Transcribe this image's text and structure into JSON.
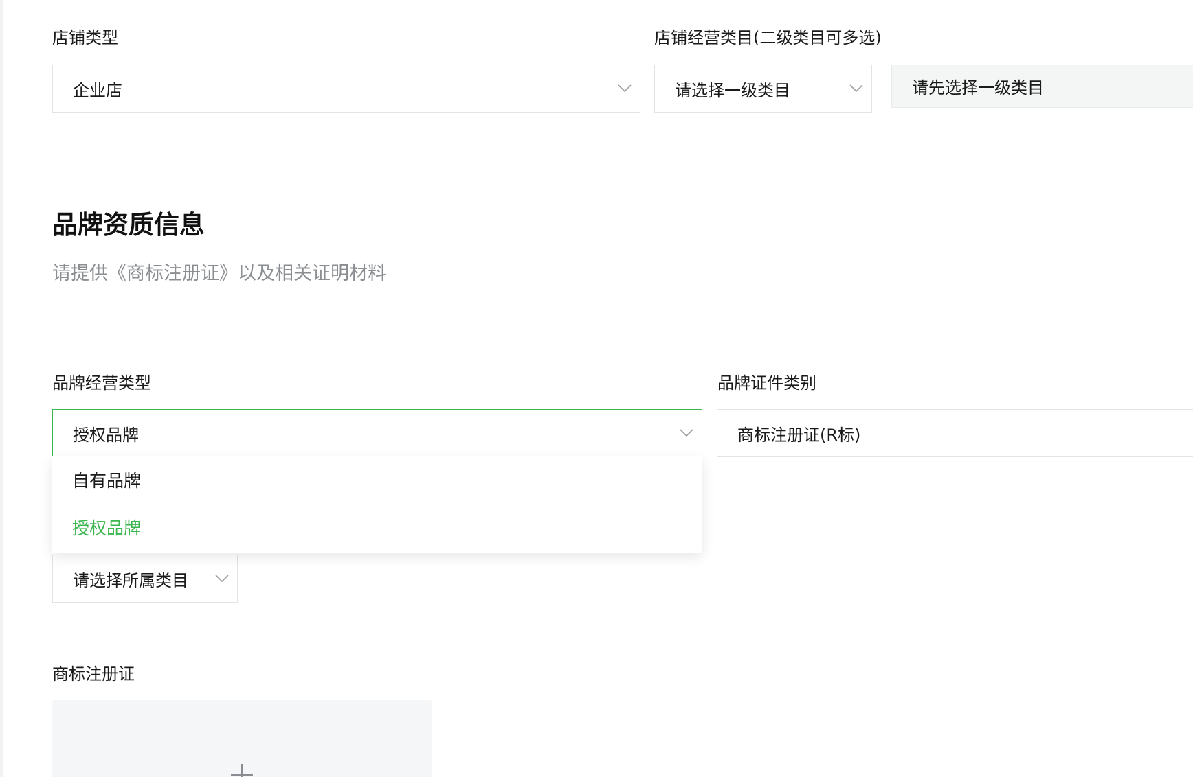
{
  "store": {
    "type_label": "店铺类型",
    "type_value": "企业店",
    "category_label": "店铺经营类目(二级类目可多选)",
    "primary_category_placeholder": "请选择一级类目",
    "secondary_category_placeholder": "请先选择一级类目"
  },
  "brand_section": {
    "title": "品牌资质信息",
    "description": "请提供《商标注册证》以及相关证明材料"
  },
  "brand": {
    "operation_type_label": "品牌经营类型",
    "operation_type_value": "授权品牌",
    "operation_type_options": [
      "自有品牌",
      "授权品牌"
    ],
    "active_option_index": 1,
    "certificate_type_label": "品牌证件类别",
    "certificate_type_value": "商标注册证(R标)",
    "category_placeholder": "请选择所属类目"
  },
  "trademark": {
    "label": "商标注册证"
  },
  "colors": {
    "accent": "#3cb64f",
    "muted_text": "#8a8d91",
    "border": "#e1e3e6"
  },
  "icons": {
    "select_arrow": "chevron-down-icon",
    "upload": "plus-icon"
  }
}
